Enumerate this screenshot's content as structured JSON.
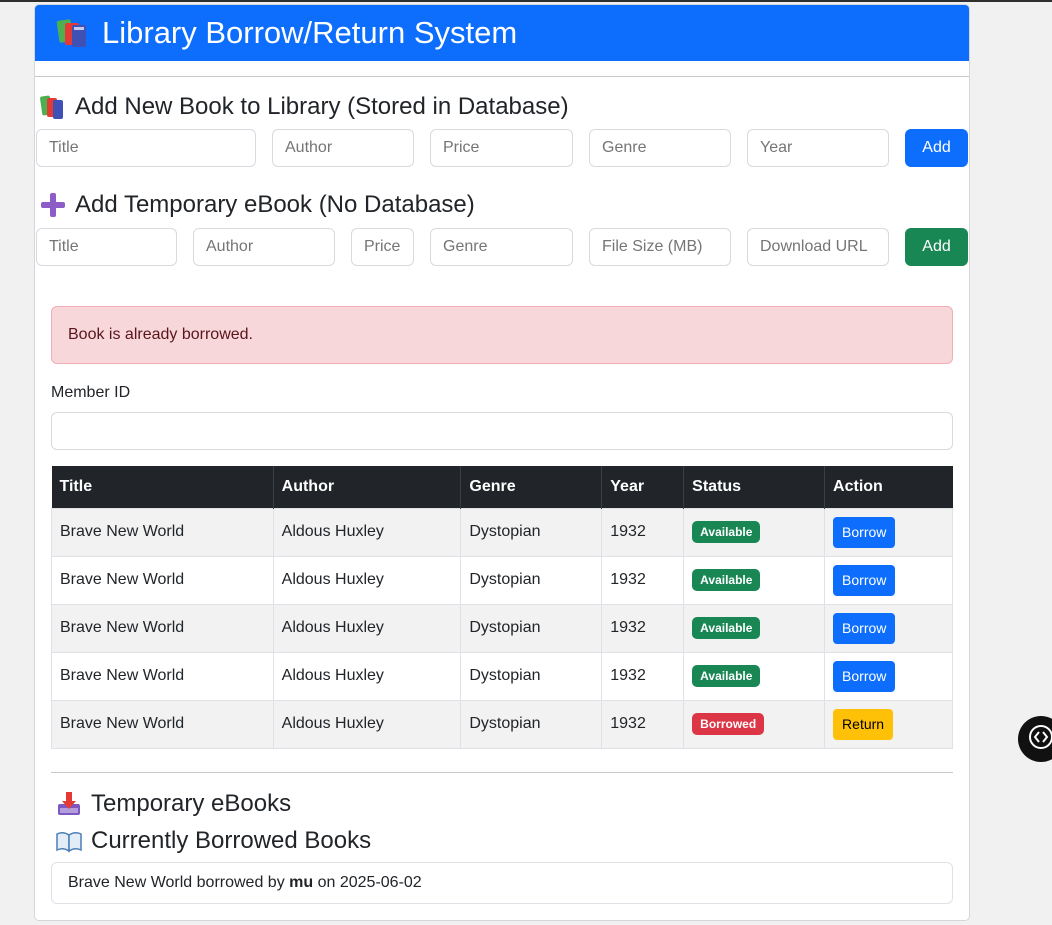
{
  "header": {
    "title": "Library Borrow/Return System"
  },
  "add_book": {
    "title": "Add New Book to Library (Stored in Database)",
    "placeholders": {
      "title": "Title",
      "author": "Author",
      "price": "Price",
      "genre": "Genre",
      "year": "Year"
    },
    "button": "Add"
  },
  "add_ebook": {
    "title": "Add Temporary eBook (No Database)",
    "placeholders": {
      "title": "Title",
      "author": "Author",
      "price": "Price",
      "genre": "Genre",
      "file_size": "File Size (MB)",
      "url": "Download URL"
    },
    "button": "Add"
  },
  "alert": {
    "message": "Book is already borrowed."
  },
  "member": {
    "label": "Member ID",
    "value": ""
  },
  "table": {
    "headers": [
      "Title",
      "Author",
      "Genre",
      "Year",
      "Status",
      "Action"
    ],
    "rows": [
      {
        "title": "Brave New World",
        "author": "Aldous Huxley",
        "genre": "Dystopian",
        "year": "1932",
        "status": "Available",
        "action": "Borrow"
      },
      {
        "title": "Brave New World",
        "author": "Aldous Huxley",
        "genre": "Dystopian",
        "year": "1932",
        "status": "Available",
        "action": "Borrow"
      },
      {
        "title": "Brave New World",
        "author": "Aldous Huxley",
        "genre": "Dystopian",
        "year": "1932",
        "status": "Available",
        "action": "Borrow"
      },
      {
        "title": "Brave New World",
        "author": "Aldous Huxley",
        "genre": "Dystopian",
        "year": "1932",
        "status": "Available",
        "action": "Borrow"
      },
      {
        "title": "Brave New World",
        "author": "Aldous Huxley",
        "genre": "Dystopian",
        "year": "1932",
        "status": "Borrowed",
        "action": "Return"
      }
    ]
  },
  "temp_ebooks": {
    "title": "Temporary eBooks"
  },
  "borrowed": {
    "title": "Currently Borrowed Books",
    "items": [
      {
        "book": "Brave New World",
        "borrowed_by_text": "borrowed by",
        "member": "mu",
        "on_text": "on",
        "date": "2025-06-02"
      }
    ]
  },
  "colors": {
    "primary": "#0d6efd",
    "success": "#198754",
    "danger": "#dc3545",
    "warning": "#ffc107",
    "dark": "#212529"
  },
  "icons": {
    "header": "books-icon",
    "add_book": "books-icon",
    "add_ebook": "plus-icon",
    "temp_ebooks": "inbox-tray-icon",
    "borrowed": "open-book-icon",
    "floating": "code-icon"
  }
}
